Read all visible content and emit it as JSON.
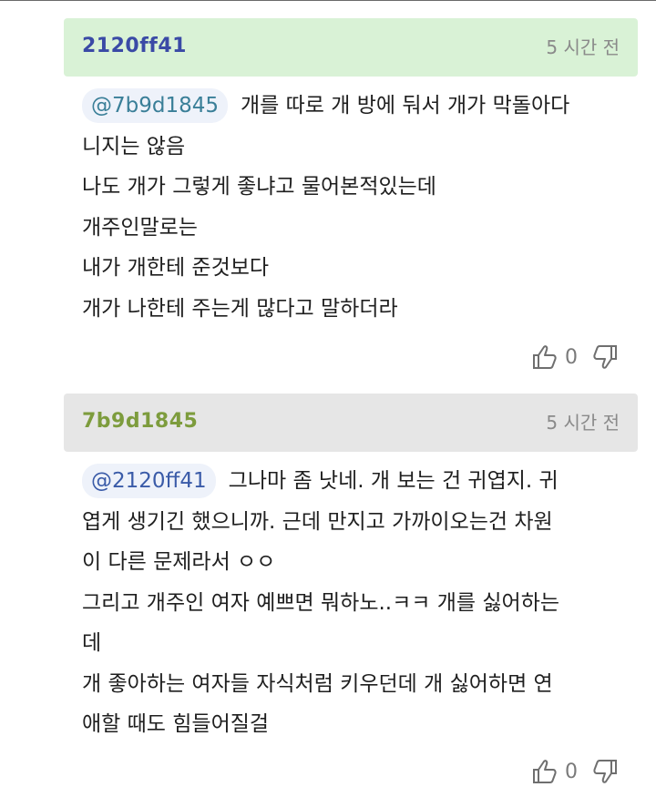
{
  "comments": [
    {
      "author": "2120ff41",
      "time": "5 시간 전",
      "mention": "@7b9d1845",
      "lines": [
        "개를 따로 개 방에 둬서 개가 막돌아다",
        "니지는 않음",
        "나도 개가 그렇게 좋냐고 물어본적있는데",
        "개주인말로는",
        "내가 개한테 준것보다",
        "개가 나한테 주는게 많다고 말하더라"
      ],
      "likes": "0"
    },
    {
      "author": "7b9d1845",
      "time": "5 시간 전",
      "mention": "@2120ff41",
      "lines": [
        "그나마 좀 낫네. 개 보는 건 귀엽지. 귀",
        "엽게 생기긴 했으니까. 근데 만지고 가까이오는건 차원",
        "이 다른 문제라서 ㅇㅇ",
        "그리고 개주인 여자 예쁘면 뭐하노..ㅋㅋ 개를 싫어하는",
        "데",
        "개 좋아하는 여자들 자식처럼 키우던데 개 싫어하면 연",
        "애할 때도 힘들어질걸"
      ],
      "likes": "0"
    }
  ],
  "icons": {
    "like": "thumbs-up-icon",
    "dislike": "thumbs-down-icon"
  }
}
